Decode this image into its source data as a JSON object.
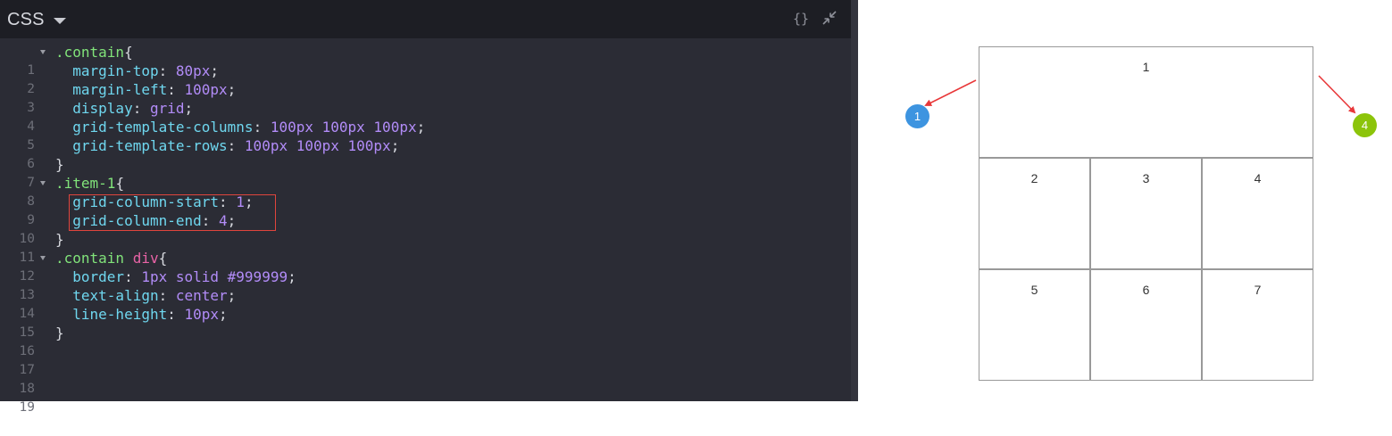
{
  "editor": {
    "language": "CSS",
    "header_buttons": {
      "format": "{}",
      "collapse": "⤡"
    },
    "line_numbers": [
      "1",
      "2",
      "3",
      "4",
      "5",
      "6",
      "7",
      "8",
      "9",
      "10",
      "11",
      "12",
      "13",
      "14",
      "15",
      "16",
      "17",
      "18",
      "19"
    ]
  },
  "code": {
    "l1": {
      "selector": ".contain",
      "brace": "{"
    },
    "l2": {
      "prop": "margin-top",
      "colon": ": ",
      "val": "80px",
      "semi": ";"
    },
    "l3": {
      "prop": "margin-left",
      "colon": ": ",
      "val": "100px",
      "semi": ";"
    },
    "l4": {
      "prop": "display",
      "colon": ": ",
      "val": "grid",
      "semi": ";"
    },
    "l5": {
      "prop": "grid-template-columns",
      "colon": ": ",
      "val": "100px 100px 100px",
      "semi": ";"
    },
    "l6": {
      "prop": "grid-template-rows",
      "colon": ": ",
      "val": "100px 100px 100px",
      "semi": ";"
    },
    "l7": {
      "brace": "}"
    },
    "l8": {
      "selector": ".item-1",
      "brace": "{"
    },
    "l9": {
      "prop": "grid-column-start",
      "colon": ": ",
      "val": "1",
      "semi": ";"
    },
    "l10": {
      "prop": "grid-column-end",
      "colon": ": ",
      "val": "4",
      "semi": ";"
    },
    "l11": {
      "brace": "}"
    },
    "l12": {
      "selector": ".contain",
      "tag": " div",
      "brace": "{"
    },
    "l13": {
      "prop": "border",
      "colon": ": ",
      "val": "1px solid #999999",
      "semi": ";"
    },
    "l14": {
      "prop": "text-align",
      "colon": ": ",
      "val": "center",
      "semi": ";"
    },
    "l15": {
      "prop": "line-height",
      "colon": ": ",
      "val": "10px",
      "semi": ";"
    },
    "l16": {
      "brace": "}"
    }
  },
  "preview": {
    "cells": [
      "1",
      "2",
      "3",
      "4",
      "5",
      "6",
      "7"
    ],
    "markers": [
      {
        "label": "1",
        "color": "#3d94e0"
      },
      {
        "label": "4",
        "color": "#8cc40a"
      }
    ],
    "arrow_color": "#e8383a"
  }
}
